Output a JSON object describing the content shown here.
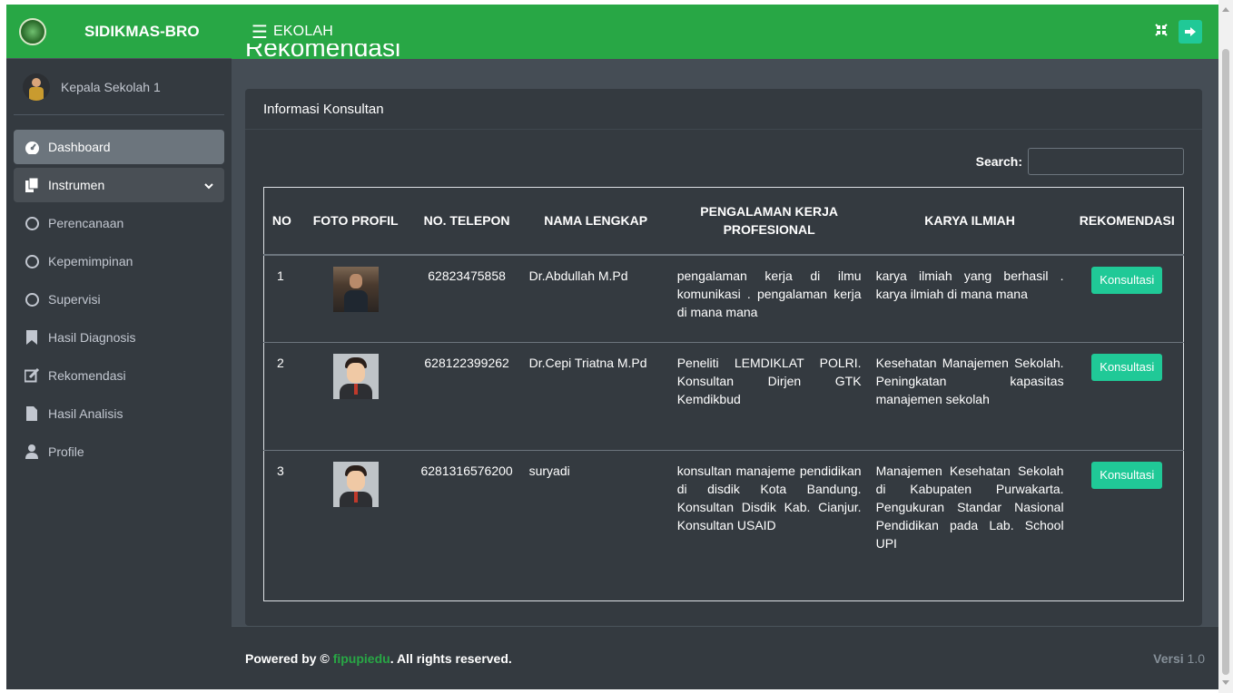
{
  "brand": {
    "name": "SIDIKMAS-BRO"
  },
  "user": {
    "name": "Kepala Sekolah 1"
  },
  "sidebar": {
    "items": [
      {
        "label": "Dashboard"
      },
      {
        "label": "Instrumen"
      },
      {
        "label": "Perencanaan"
      },
      {
        "label": "Kepemimpinan"
      },
      {
        "label": "Supervisi"
      },
      {
        "label": "Hasil Diagnosis"
      },
      {
        "label": "Rekomendasi"
      },
      {
        "label": "Hasil Analisis"
      },
      {
        "label": "Profile"
      }
    ]
  },
  "header": {
    "title": "EKOLAH"
  },
  "page": {
    "heading": "Rekomendasi"
  },
  "card": {
    "title": "Informasi Konsultan",
    "search_label": "Search:",
    "search_value": ""
  },
  "table": {
    "headers": [
      "NO",
      "FOTO PROFIL",
      "NO. TELEPON",
      "NAMA LENGKAP",
      "PENGALAMAN KERJA PROFESIONAL",
      "KARYA ILMIAH",
      "REKOMENDASI"
    ],
    "rows": [
      {
        "no": "1",
        "phone": "62823475858",
        "name": "Dr.Abdullah M.Pd",
        "experience": "pengalaman kerja di ilmu komunikasi . pengalaman kerja di mana mana",
        "works": "karya ilmiah yang berhasil . karya ilmiah di mana mana",
        "action": "Konsultasi"
      },
      {
        "no": "2",
        "phone": "628122399262",
        "name": "Dr.Cepi Triatna M.Pd",
        "experience": "Peneliti LEMDIKLAT POLRI. Konsultan Dirjen GTK Kemdikbud",
        "works": "Kesehatan Manajemen Sekolah. Peningkatan kapasitas manajemen sekolah",
        "action": "Konsultasi"
      },
      {
        "no": "3",
        "phone": "6281316576200",
        "name": "suryadi",
        "experience": "konsultan manajeme pendidikan di disdik Kota Bandung. Konsultan Disdik Kab. Cianjur. Konsultan USAID",
        "works": "Manajemen Kesehatan Sekolah di Kabupaten Purwakarta. Pengukuran Standar Nasional Pendidikan pada Lab. School UPI",
        "action": "Konsultasi"
      }
    ]
  },
  "footer": {
    "prefix": "Powered by © ",
    "link": "fipupiedu",
    "suffix": ". All rights reserved.",
    "version_label": "Versi",
    "version_value": "1.0"
  },
  "colors": {
    "brand_green": "#28a745",
    "accent_teal": "#20c997",
    "sidebar_bg": "#343a40",
    "content_bg": "#454d55"
  }
}
